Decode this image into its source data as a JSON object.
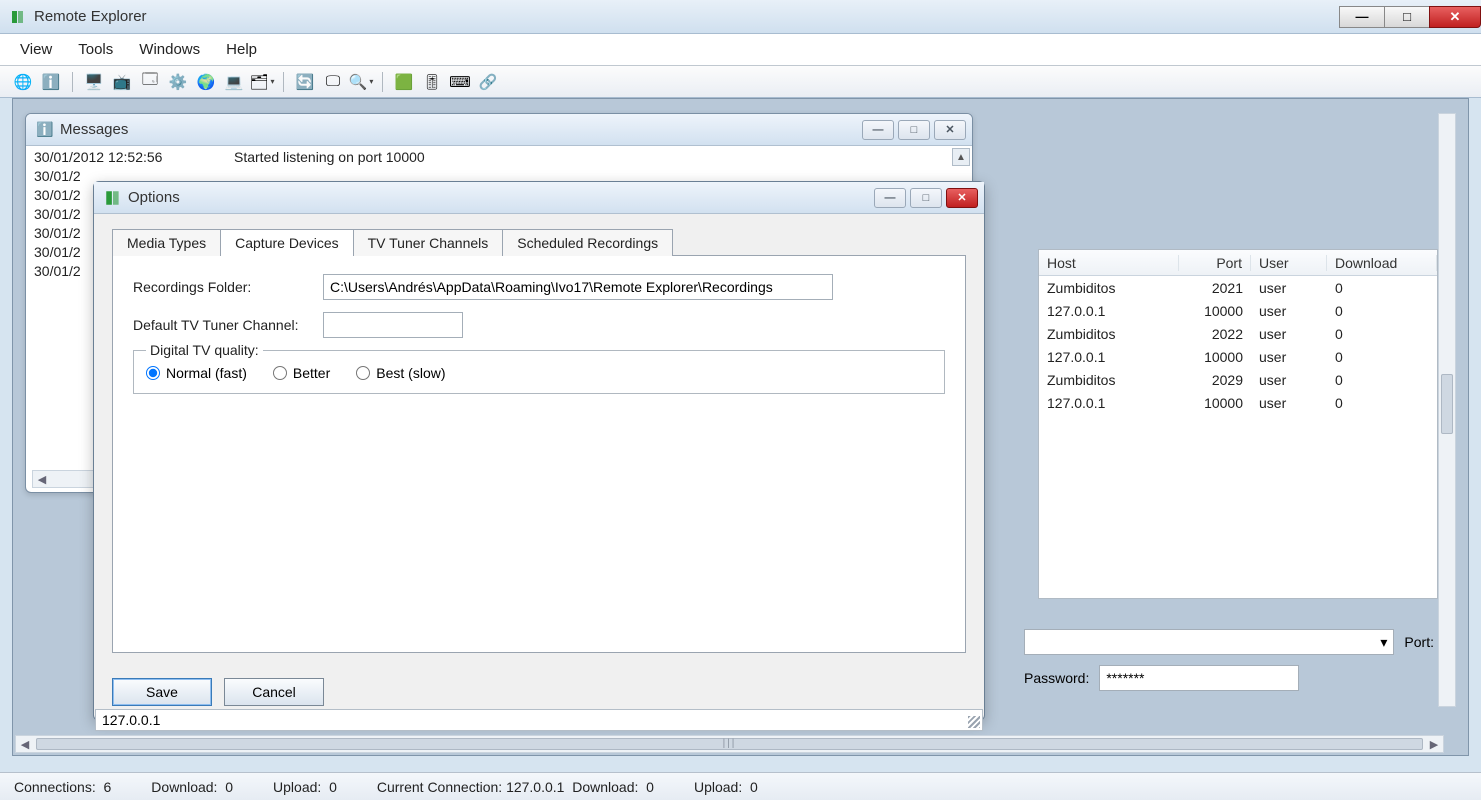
{
  "window": {
    "title": "Remote Explorer"
  },
  "menubar": [
    "View",
    "Tools",
    "Windows",
    "Help"
  ],
  "toolbar_icons": [
    "network-icon",
    "info-icon",
    "monitor-icon",
    "monitor-add-icon",
    "window-icon",
    "gear-icon",
    "globe-icon",
    "computer-icon",
    "dropdown-icon",
    "refresh-icon",
    "display-icon",
    "search-icon",
    "chip-icon",
    "tune-icon",
    "terminal-icon",
    "link-icon"
  ],
  "messages_panel": {
    "title": "Messages",
    "rows": [
      {
        "time": "30/01/2012 12:52:56",
        "text": "Started listening on port 10000"
      },
      {
        "time": "30/01/2",
        "text": ""
      },
      {
        "time": "30/01/2",
        "text": ""
      },
      {
        "time": "30/01/2",
        "text": ""
      },
      {
        "time": "30/01/2",
        "text": ""
      },
      {
        "time": "30/01/2",
        "text": ""
      },
      {
        "time": "30/01/2",
        "text": ""
      }
    ]
  },
  "options_dialog": {
    "title": "Options",
    "tabs": [
      "Media Types",
      "Capture Devices",
      "TV Tuner Channels",
      "Scheduled Recordings"
    ],
    "active_tab": 1,
    "recordings_folder_label": "Recordings Folder:",
    "recordings_folder_value": "C:\\Users\\Andrés\\AppData\\Roaming\\Ivo17\\Remote Explorer\\Recordings",
    "default_channel_label": "Default TV Tuner Channel:",
    "default_channel_value": "",
    "quality_legend": "Digital TV quality:",
    "quality_options": [
      "Normal (fast)",
      "Better",
      "Best (slow)"
    ],
    "quality_selected": 0,
    "save_label": "Save",
    "cancel_label": "Cancel"
  },
  "ip_footer": "127.0.0.1",
  "connections_table": {
    "headers": {
      "host": "Host",
      "port": "Port",
      "user": "User",
      "download": "Download"
    },
    "rows": [
      {
        "host": "Zumbiditos",
        "port": "2021",
        "user": "user",
        "download": "0"
      },
      {
        "host": "127.0.0.1",
        "port": "10000",
        "user": "user",
        "download": "0"
      },
      {
        "host": "Zumbiditos",
        "port": "2022",
        "user": "user",
        "download": "0"
      },
      {
        "host": "127.0.0.1",
        "port": "10000",
        "user": "user",
        "download": "0"
      },
      {
        "host": "Zumbiditos",
        "port": "2029",
        "user": "user",
        "download": "0"
      },
      {
        "host": "127.0.0.1",
        "port": "10000",
        "user": "user",
        "download": "0"
      }
    ]
  },
  "cred": {
    "port_label": "Port:",
    "password_label": "Password:",
    "password_value": "*******"
  },
  "statusbar": {
    "connections_label": "Connections:",
    "connections_value": "6",
    "download_label": "Download:",
    "download_value": "0",
    "upload_label": "Upload:",
    "upload_value": "0",
    "current_label": "Current Connection:",
    "current_value": "127.0.0.1",
    "cur_dl_label": "Download:",
    "cur_dl_value": "0",
    "cur_ul_label": "Upload:",
    "cur_ul_value": "0"
  }
}
